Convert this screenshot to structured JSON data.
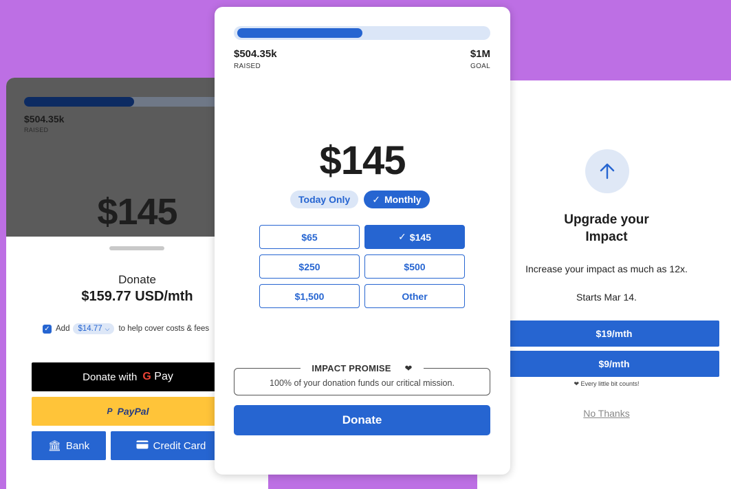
{
  "left_card": {
    "raised_amount": "$504.35k",
    "raised_label": "RAISED",
    "raised_progress_fraction": 0.5,
    "big_amount": "$145",
    "donate_label": "Donate",
    "donate_total": "$159.77 USD/mth",
    "fee": {
      "prefix": "Add",
      "amount": "$14.77",
      "suffix": "to help cover costs & fees"
    },
    "buttons": {
      "gpay_label": "Donate with",
      "gpay_brand_g": "G",
      "gpay_brand_pay": "Pay",
      "paypal_pay": "PayPal",
      "bank_label": "Bank",
      "card_label": "Credit Card"
    }
  },
  "middle_card": {
    "raised_amount": "$504.35k",
    "raised_label": "RAISED",
    "goal_amount": "$1M",
    "goal_label": "GOAL",
    "raised_progress_fraction": 0.5,
    "big_amount": "$145",
    "frequency": {
      "today_label": "Today Only",
      "monthly_label": "Monthly",
      "selected": "Monthly"
    },
    "amounts": [
      {
        "label": "$65",
        "selected": false
      },
      {
        "label": "$145",
        "selected": true
      },
      {
        "label": "$250",
        "selected": false
      },
      {
        "label": "$500",
        "selected": false
      },
      {
        "label": "$1,500",
        "selected": false
      },
      {
        "label": "Other",
        "selected": false
      }
    ],
    "promise_title": "IMPACT PROMISE",
    "promise_text": "100% of your donation funds our critical mission.",
    "donate_label": "Donate"
  },
  "right_card": {
    "title_line1": "Upgrade your",
    "title_line2": "Impact",
    "description": "Increase your impact as much as 12x.",
    "start_text": "Starts Mar 14.",
    "option_1": "$19/mth",
    "option_2": "$9/mth",
    "note": "Every little bit counts!",
    "no_thanks": "No Thanks"
  },
  "colors": {
    "background": "#bd6fe4",
    "accent_blue": "#2665d1",
    "paypal_yellow": "#ffc439"
  }
}
